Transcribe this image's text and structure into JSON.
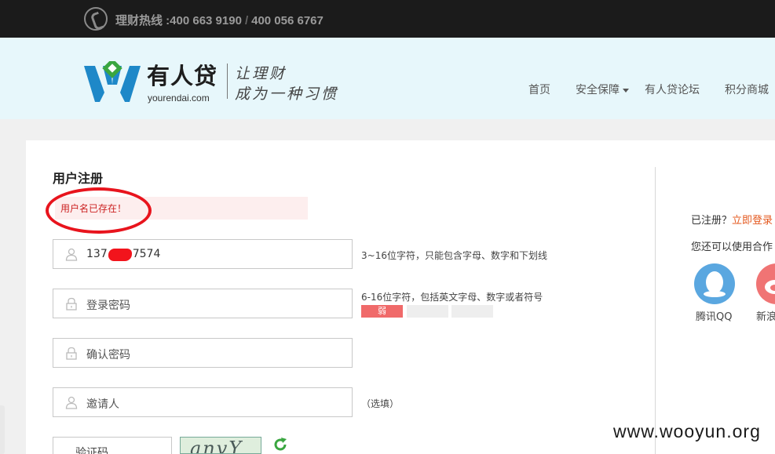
{
  "topbar": {
    "hotline_label": "理财热线 :",
    "phone_1": "400 663 9190",
    "separator": "/",
    "phone_2": "400 056 6767"
  },
  "header": {
    "brand_name": "有人贷",
    "brand_url": "yourendai.com",
    "slogan_line1": "让理财",
    "slogan_line2": "成为一种习惯",
    "nav": [
      "首页",
      "安全保障",
      "有人贷论坛",
      "积分商城"
    ]
  },
  "form": {
    "title": "用户注册",
    "error_message": "用户名已存在！",
    "username_value_prefix": "137",
    "username_value_suffix": "7574",
    "username_hint": "3~16位字符，只能包含字母、数字和下划线",
    "password_placeholder": "登录密码",
    "password_hint": "6-16位字符，包括英文字母、数字或者符号",
    "strength_weak_label": "弱",
    "confirm_placeholder": "确认密码",
    "inviter_placeholder": "邀请人",
    "inviter_hint": "（选填）",
    "captcha_placeholder": "验证码",
    "captcha_text": "anvY"
  },
  "sidebar": {
    "registered_prefix": "已注册？",
    "login_link": "立即登录",
    "partner_text": "您还可以使用合作",
    "partners": [
      "腾讯QQ",
      "新浪"
    ]
  },
  "watermark": "www.wooyun.org",
  "colors": {
    "topbar_bg": "#1b1b1b",
    "header_bg": "#e7f7fb",
    "brand_blue": "#1e88c8",
    "error_red": "#cc2222",
    "link_orange": "#e4581e"
  }
}
